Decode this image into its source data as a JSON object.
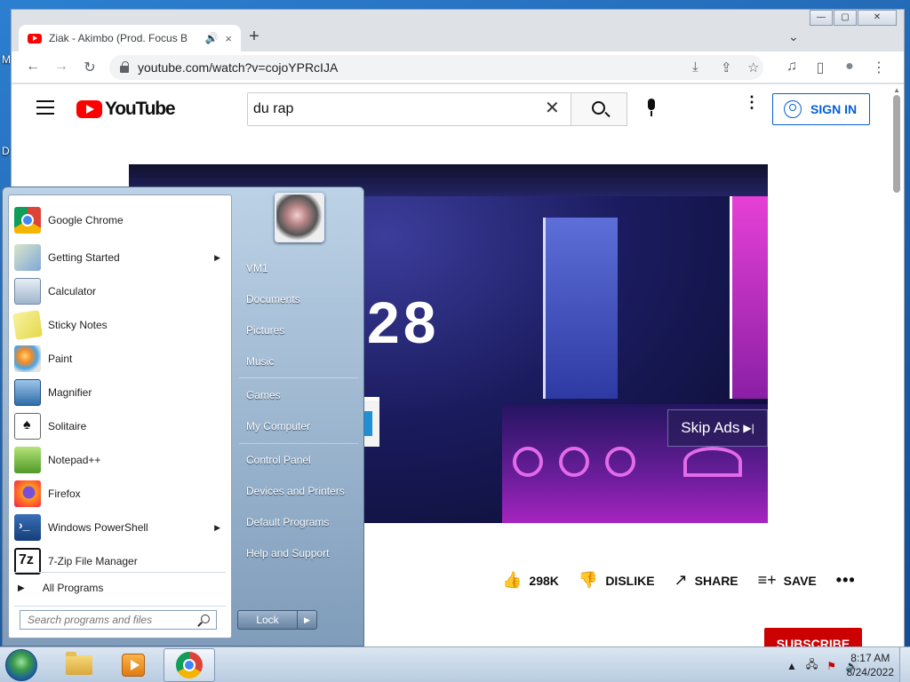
{
  "desktop": {
    "letters": [
      "M",
      "D"
    ]
  },
  "browser": {
    "tab_title": "Ziak - Akimbo (Prod. Focus B",
    "tab_audio_icon": "speaker-icon",
    "tab_close": "×",
    "new_tab": "+",
    "tab_search": "⌄",
    "window_buttons": {
      "minimize": "—",
      "restore": "▢",
      "close": "✕"
    },
    "url": "youtube.com/watch?v=cojoYPRcIJA",
    "nav": {
      "back": "←",
      "forward": "→",
      "reload": "↻"
    },
    "omnibox_icons": {
      "install": "⤓",
      "share": "⇪",
      "bookmark": "☆"
    },
    "right_icons": {
      "media": "♫",
      "sidepanel": "▯",
      "profile": "●",
      "menu": "⋮"
    }
  },
  "youtube": {
    "logo_text": "YouTube",
    "search_value": "du rap",
    "search_clear": "✕",
    "more": "⋮",
    "sign_in_label": "SIGN IN",
    "video_overlay_text": "28",
    "skip_ads_label": "Skip Ads",
    "skip_ads_icon": "▶|",
    "actions": {
      "like_icon": "👍",
      "like_count": "298K",
      "dislike_icon": "👎",
      "dislike_label": "DISLIKE",
      "share_icon": "↗",
      "share_label": "SHARE",
      "save_icon": "≡+",
      "save_label": "SAVE",
      "more": "•••"
    },
    "subscribe_label": "SUBSCRIBE"
  },
  "start_menu": {
    "programs": [
      {
        "label": "Google Chrome",
        "icon": "chrome-icon",
        "has_submenu": false
      },
      {
        "label": "Getting Started",
        "icon": "getting-started-icon",
        "has_submenu": true
      },
      {
        "label": "Calculator",
        "icon": "calculator-icon",
        "has_submenu": false
      },
      {
        "label": "Sticky Notes",
        "icon": "sticky-notes-icon",
        "has_submenu": false
      },
      {
        "label": "Paint",
        "icon": "paint-icon",
        "has_submenu": false
      },
      {
        "label": "Magnifier",
        "icon": "magnifier-icon",
        "has_submenu": false
      },
      {
        "label": "Solitaire",
        "icon": "solitaire-icon",
        "has_submenu": false
      },
      {
        "label": "Notepad++",
        "icon": "notepad-plus-plus-icon",
        "has_submenu": false
      },
      {
        "label": "Firefox",
        "icon": "firefox-icon",
        "has_submenu": false
      },
      {
        "label": "Windows PowerShell",
        "icon": "powershell-icon",
        "has_submenu": true
      },
      {
        "label": "7-Zip File Manager",
        "icon": "seven-zip-icon",
        "has_submenu": false
      }
    ],
    "submenu_arrow": "▶",
    "all_programs_label": "All Programs",
    "all_programs_arrow": "▶",
    "search_placeholder": "Search programs and files",
    "right_items": [
      "VM1",
      "Documents",
      "Pictures",
      "Music",
      "Games",
      "My Computer",
      "Control Panel",
      "Devices and Printers",
      "Default Programs",
      "Help and Support"
    ],
    "lock_label": "Lock",
    "lock_arrow": "▶"
  },
  "taskbar": {
    "apps": [
      "file-explorer-icon",
      "media-player-icon",
      "chrome-icon"
    ],
    "tray": {
      "expand": "▲",
      "network": "🖧",
      "flag": "⚑",
      "volume": "🔊"
    },
    "time": "8:17 AM",
    "date": "8/24/2022"
  }
}
